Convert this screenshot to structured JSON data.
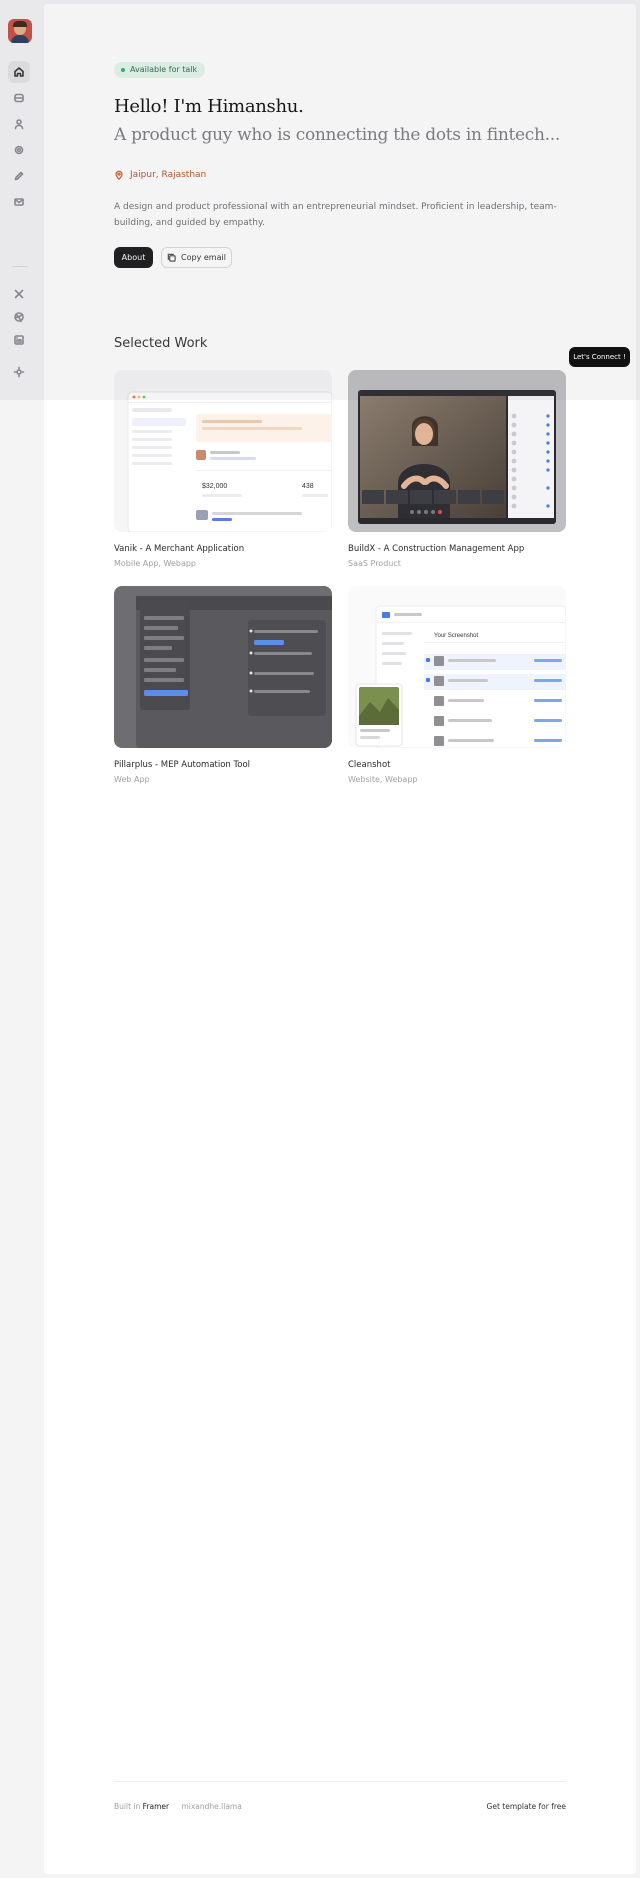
{
  "sidebar": {
    "items": [
      {
        "icon": "home-icon",
        "label": "Home",
        "active": true
      },
      {
        "icon": "projects-icon",
        "label": "Work"
      },
      {
        "icon": "user-icon",
        "label": "About"
      },
      {
        "icon": "globe-icon",
        "label": "Explore"
      },
      {
        "icon": "pencil-icon",
        "label": "Writing"
      },
      {
        "icon": "mail-icon",
        "label": "Contact"
      }
    ],
    "socials": [
      {
        "icon": "x-twitter-icon",
        "label": "X"
      },
      {
        "icon": "dribbble-icon",
        "label": "Dribbble"
      },
      {
        "icon": "linkedin-icon",
        "label": "LinkedIn"
      },
      {
        "icon": "theme-toggle-icon",
        "label": "Theme"
      }
    ]
  },
  "hero": {
    "badge": "Available for talk",
    "title": "Hello! I'm Himanshu.",
    "subtitle": "A product guy who is connecting the dots in fintech...",
    "location": "Jaipur, Rajasthan",
    "description": "A design and product professional with an entrepreneurial mindset. Proficient in leadership, team-building, and guided by empathy.",
    "about_button": "About",
    "copy_button": "Copy email"
  },
  "work": {
    "title": "Selected Work",
    "projects": [
      {
        "title": "Vanik - A Merchant Application",
        "subtitle": "Mobile App, Webapp"
      },
      {
        "title": "BuildX - A Construction Management App",
        "subtitle": "SaaS Product"
      },
      {
        "title": "Pillarplus - MEP Automation Tool",
        "subtitle": "Web App"
      },
      {
        "title": "Cleanshot",
        "subtitle": "Website, Webapp"
      }
    ],
    "vanik_preview": {
      "amount": "$32,000",
      "count": "438"
    },
    "cleanshot_preview": {
      "heading": "Your Screenshot"
    }
  },
  "cta": {
    "label": "Let's Connect !"
  },
  "footer": {
    "built_prefix": "Built in",
    "built_tool": "Framer",
    "credit": "mixandhe.llama",
    "template_link": "Get template for free"
  },
  "colors": {
    "accent": "#1a1a1c",
    "badge_bg": "#e3f7ec",
    "badge_dot": "#1fb86a",
    "location": "#b4562a"
  }
}
